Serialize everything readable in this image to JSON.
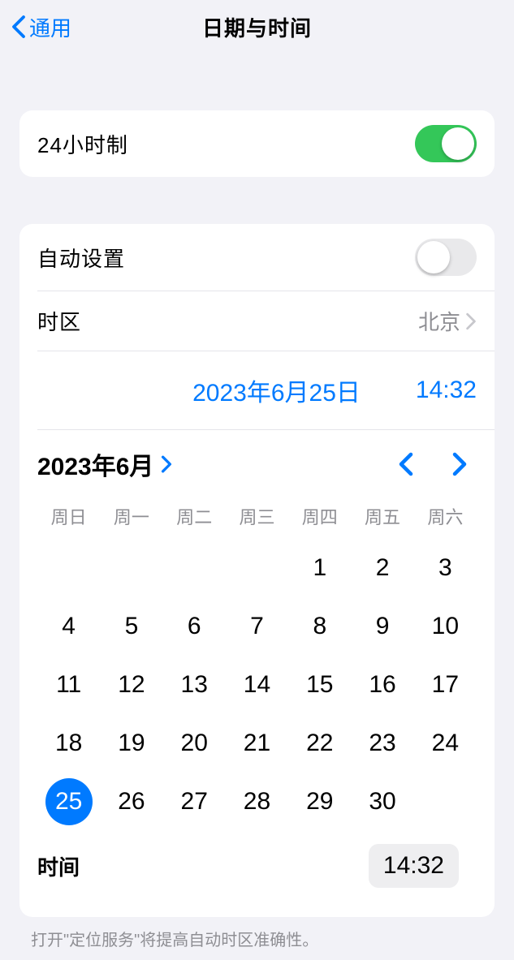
{
  "header": {
    "back": "通用",
    "title": "日期与时间"
  },
  "hour24": {
    "label": "24小时制",
    "on": true
  },
  "auto": {
    "label": "自动设置",
    "on": false
  },
  "timezone": {
    "label": "时区",
    "value": "北京"
  },
  "selected": {
    "date": "2023年6月25日",
    "time": "14:32"
  },
  "calendar": {
    "month": "2023年6月",
    "weekdays": [
      "周日",
      "周一",
      "周二",
      "周三",
      "周四",
      "周五",
      "周六"
    ],
    "weeks": [
      [
        "",
        "",
        "",
        "",
        "1",
        "2",
        "3"
      ],
      [
        "4",
        "5",
        "6",
        "7",
        "8",
        "9",
        "10"
      ],
      [
        "11",
        "12",
        "13",
        "14",
        "15",
        "16",
        "17"
      ],
      [
        "18",
        "19",
        "20",
        "21",
        "22",
        "23",
        "24"
      ],
      [
        "25",
        "26",
        "27",
        "28",
        "29",
        "30",
        ""
      ]
    ],
    "selected_day": "25"
  },
  "time_row": {
    "label": "时间",
    "value": "14:32"
  },
  "footnote": "打开\"定位服务\"将提高自动时区准确性。"
}
